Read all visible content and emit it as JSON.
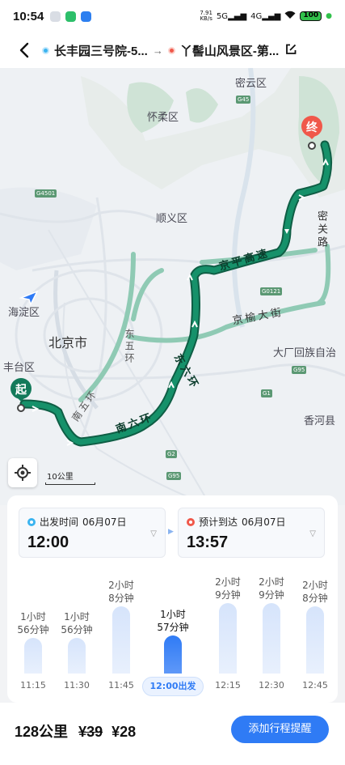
{
  "status_bar": {
    "time": "10:54",
    "net_speed_top": "7.91",
    "net_speed_bottom": "KB/s",
    "net_5g": "5G",
    "net_4g": "4G",
    "battery": "100"
  },
  "header": {
    "origin": "长丰园三号院-5...",
    "destination": "丫髻山风景区-第...",
    "arrow": "→"
  },
  "map": {
    "labels": {
      "miyun": "密云区",
      "huairou": "怀柔区",
      "shunyi": "顺义区",
      "haidian": "海淀区",
      "beijing": "北京市",
      "fengtai": "丰台区",
      "dachang": "大厂回族自治",
      "xianghe": "香河县"
    },
    "badges": {
      "g45": "G45",
      "g4501": "G4501",
      "g0121": "G0121",
      "g95a": "G95",
      "g1": "G1",
      "g2": "G2",
      "g95b": "G95"
    },
    "roads": {
      "jingping": "京平高速",
      "miguan": "密关路",
      "jingyu": "京榆大街",
      "dongwuhuan": "东五环",
      "nanwuhuan": "南五环",
      "nanliuhuan": "南六环",
      "dongliuhuan": "东六环"
    },
    "start_marker": "起",
    "end_marker": "终",
    "scale": "10公里"
  },
  "panel": {
    "depart": {
      "label": "出发时间",
      "date": "06月07日",
      "time": "12:00"
    },
    "arrive": {
      "label": "预计到达",
      "date": "06月07日",
      "time": "13:57"
    },
    "slots": [
      {
        "time": "11:15",
        "duration_line1": "1小时",
        "duration_line2": "56分钟",
        "minutes": 116
      },
      {
        "time": "11:30",
        "duration_line1": "1小时",
        "duration_line2": "56分钟",
        "minutes": 116
      },
      {
        "time": "11:45",
        "duration_line1": "2小时",
        "duration_line2": "8分钟",
        "minutes": 128
      },
      {
        "time": "12:00出发",
        "duration_line1": "1小时",
        "duration_line2": "57分钟",
        "minutes": 117,
        "selected": true
      },
      {
        "time": "12:15",
        "duration_line1": "2小时",
        "duration_line2": "9分钟",
        "minutes": 129
      },
      {
        "time": "12:30",
        "duration_line1": "2小时",
        "duration_line2": "9分钟",
        "minutes": 129
      },
      {
        "time": "12:45",
        "duration_line1": "2小时",
        "duration_line2": "8分钟",
        "minutes": 128
      }
    ]
  },
  "footer": {
    "distance": "128公里",
    "old_price": "¥39",
    "new_price": "¥28",
    "remind_button": "添加行程提醒"
  },
  "colors": {
    "route": "#137a5a",
    "route_alt": "#8fcab4",
    "accent": "#2f7bf5",
    "start": "#137a5a",
    "end": "#f0584a"
  }
}
